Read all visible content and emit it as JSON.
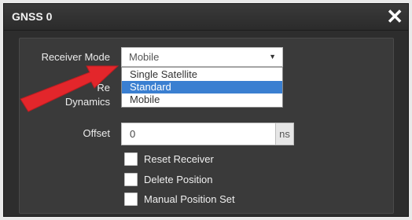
{
  "dialog": {
    "title": "GNSS 0",
    "close_glyph": "✕"
  },
  "receiver_mode": {
    "label": "Receiver Mode",
    "selected": "Mobile",
    "dropdown_arrow": "▼",
    "options": [
      "Single Satellite",
      "Standard",
      "Mobile"
    ],
    "highlighted_option": "Standard"
  },
  "receiver_dynamics": {
    "label_line1": "Re",
    "label_line2": "Dynamics"
  },
  "offset": {
    "label": "Offset",
    "value": "0",
    "unit": "ns"
  },
  "checkboxes": [
    {
      "label": "Reset Receiver",
      "checked": false
    },
    {
      "label": "Delete Position",
      "checked": false
    },
    {
      "label": "Manual Position Set",
      "checked": false
    }
  ],
  "colors": {
    "dialog_bg": "#2d2d2d",
    "panel_bg": "#3a3a3a",
    "selection": "#3a7fd1",
    "annotation_arrow": "#e3262b"
  },
  "annotation": {
    "icon": "red-pointer-arrow-icon"
  }
}
